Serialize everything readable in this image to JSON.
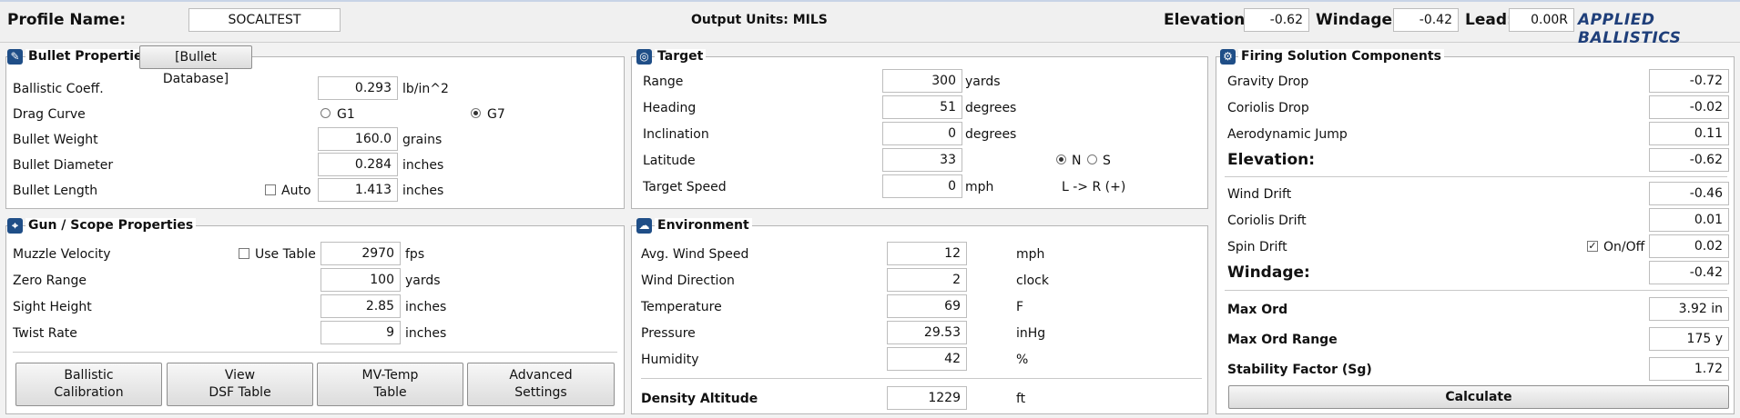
{
  "header": {
    "profile_label": "Profile Name:",
    "profile_value": "SOCALTEST",
    "output_units": "Output Units: MILS",
    "elevation_label": "Elevation:",
    "elevation_value": "-0.62",
    "windage_label": "Windage:",
    "windage_value": "-0.42",
    "lead_label": "Lead:",
    "lead_value": "0.00R",
    "brand": "APPLIED BALLISTICS"
  },
  "bullet": {
    "title": "Bullet Properties",
    "db_button": "[Bullet Database]",
    "bc_label": "Ballistic Coeff.",
    "bc_value": "0.293",
    "bc_unit": "lb/in^2",
    "drag_label": "Drag Curve",
    "g1": "G1",
    "g7": "G7",
    "drag_selected": "G7",
    "weight_label": "Bullet Weight",
    "weight_value": "160.0",
    "weight_unit": "grains",
    "diameter_label": "Bullet Diameter",
    "diameter_value": "0.284",
    "diameter_unit": "inches",
    "length_label": "Bullet Length",
    "auto_label": "Auto",
    "auto_checked": false,
    "length_value": "1.413",
    "length_unit": "inches"
  },
  "gun": {
    "title": "Gun / Scope  Properties",
    "mv_label": "Muzzle Velocity",
    "use_table_label": "Use Table",
    "use_table_checked": false,
    "mv_value": "2970",
    "mv_unit": "fps",
    "zero_label": "Zero Range",
    "zero_value": "100",
    "zero_unit": "yards",
    "sight_label": "Sight Height",
    "sight_value": "2.85",
    "sight_unit": "inches",
    "twist_label": "Twist Rate",
    "twist_value": "9",
    "twist_unit": "inches",
    "buttons": [
      "Ballistic\nCalibration",
      "View\nDSF Table",
      "MV-Temp\nTable",
      "Advanced\nSettings"
    ]
  },
  "target": {
    "title": "Target",
    "range_label": "Range",
    "range_value": "300",
    "range_unit": "yards",
    "heading_label": "Heading",
    "heading_value": "51",
    "heading_unit": "degrees",
    "inclination_label": "Inclination",
    "inclination_value": "0",
    "inclination_unit": "degrees",
    "latitude_label": "Latitude",
    "latitude_value": "33",
    "n_label": "N",
    "s_label": "S",
    "hemisphere_selected": "N",
    "speed_label": "Target Speed",
    "speed_value": "0",
    "speed_unit": "mph",
    "direction_note": "L -> R (+)"
  },
  "environment": {
    "title": "Environment",
    "wind_speed_label": "Avg. Wind Speed",
    "wind_speed_value": "12",
    "wind_speed_unit": "mph",
    "wind_dir_label": "Wind Direction",
    "wind_dir_value": "2",
    "wind_dir_unit": "clock",
    "temp_label": "Temperature",
    "temp_value": "69",
    "temp_unit": "F",
    "pressure_label": "Pressure",
    "pressure_value": "29.53",
    "pressure_unit": "inHg",
    "humidity_label": "Humidity",
    "humidity_value": "42",
    "humidity_unit": "%",
    "da_label": "Density Altitude",
    "da_value": "1229",
    "da_unit": "ft"
  },
  "solution": {
    "title": "Firing Solution Components",
    "gravity_label": "Gravity Drop",
    "gravity_value": "-0.72",
    "coriolis_drop_label": "Coriolis Drop",
    "coriolis_drop_value": "-0.02",
    "aero_label": "Aerodynamic Jump",
    "aero_value": "0.11",
    "elevation_label": "Elevation:",
    "elevation_value": "-0.62",
    "wind_drift_label": "Wind Drift",
    "wind_drift_value": "-0.46",
    "coriolis_drift_label": "Coriolis Drift",
    "coriolis_drift_value": "0.01",
    "spin_label": "Spin Drift",
    "spin_onoff_label": "On/Off",
    "spin_checked": true,
    "spin_value": "0.02",
    "windage_label": "Windage:",
    "windage_value": "-0.42",
    "max_ord_label": "Max Ord",
    "max_ord_value": "3.92 in",
    "max_ord_range_label": "Max Ord Range",
    "max_ord_range_value": "175 y",
    "stability_label": "Stability Factor (Sg)",
    "stability_value": "1.72",
    "calculate_label": "Calculate"
  },
  "colors": {
    "accent": "#1f4e87",
    "brand": "#1f3f7a"
  }
}
